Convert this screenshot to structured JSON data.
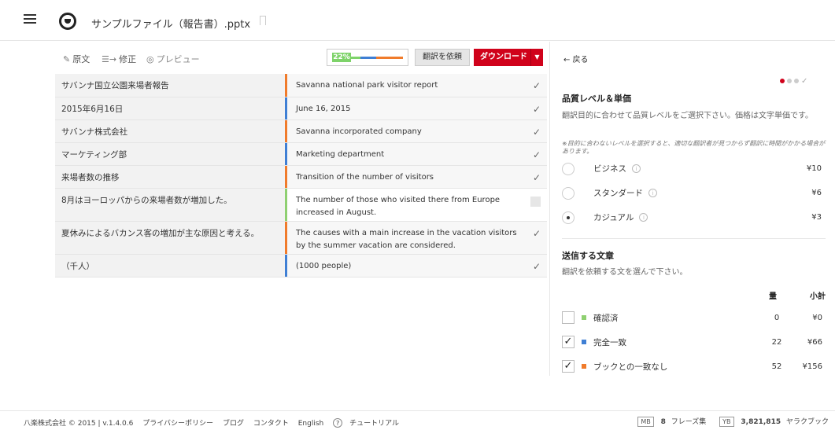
{
  "header": {
    "file_title": "サンプルファイル（報告書）.pptx"
  },
  "toolbar": {
    "modes": [
      "原文",
      "修正",
      "プレビュー"
    ],
    "progress_pct": "22%",
    "progress_fraction": 0.22,
    "request_label": "翻訳を依頼",
    "download_label": "ダウンロード",
    "colors": {
      "green": "#7ed36a",
      "orange": "#f07b2b",
      "blue": "#3f7fd4",
      "red": "#d0021b"
    }
  },
  "segments": [
    {
      "src": "サバンナ国立公園来場者報告",
      "tgt": "Savanna national park visitor report",
      "status": "orange",
      "checked": true
    },
    {
      "src": "2015年6月16日",
      "tgt": "June 16, 2015",
      "status": "blue",
      "checked": true
    },
    {
      "src": "サバンナ株式会社",
      "tgt": "Savanna incorporated company",
      "status": "orange",
      "checked": true
    },
    {
      "src": "マーケティング部",
      "tgt": "Marketing department",
      "status": "blue",
      "checked": true
    },
    {
      "src": "来場者数の推移",
      "tgt": "Transition of the number of visitors",
      "status": "orange",
      "checked": true
    },
    {
      "src": "8月はヨーロッパからの来場者数が増加した。",
      "tgt": "The number of those who visited there from Europe increased in August.",
      "status": "green",
      "checked": false
    },
    {
      "src": "夏休みによるバカンス客の増加が主な原因と考える。",
      "tgt": "The causes with a main increase in the vacation visitors by the summer vacation are considered.",
      "status": "orange",
      "checked": true
    },
    {
      "src": "（千人）",
      "tgt": "(1000 people)",
      "status": "blue",
      "checked": true
    }
  ],
  "panel": {
    "back_label": "← 戻る",
    "quality_title": "品質レベル＆単価",
    "quality_desc": "翻訳目的に合わせて品質レベルをご選択下さい。価格は文字単価です。",
    "quality_note": "※目的に合わないレベルを選択すると、適切な翻訳者が見つからず翻訳に時間がかかる場合があります。",
    "levels": [
      {
        "label": "ビジネス",
        "price": "¥10",
        "selected": false
      },
      {
        "label": "スタンダード",
        "price": "¥6",
        "selected": false
      },
      {
        "label": "カジュアル",
        "price": "¥3",
        "selected": true
      }
    ],
    "send_title": "送信する文章",
    "send_desc": "翻訳を依頼する文を選んで下さい。",
    "col_qty": "量",
    "col_subtotal": "小計",
    "send_rows": [
      {
        "label": "確認済",
        "qty": "0",
        "subtotal": "¥0",
        "checked": false,
        "color": "#8fd071"
      },
      {
        "label": "完全一致",
        "qty": "22",
        "subtotal": "¥66",
        "checked": true,
        "color": "#3f7fd4"
      },
      {
        "label": "ブックとの一致なし",
        "qty": "52",
        "subtotal": "¥156",
        "checked": true,
        "color": "#f07b2b"
      }
    ]
  },
  "footer": {
    "copyright": "八楽株式会社 © 2015 | v.1.4.0.6",
    "links": [
      "プライバシーポリシー",
      "ブログ",
      "コンタクト",
      "English"
    ],
    "tutorial": "チュートリアル",
    "mb_badge": "MB",
    "phrase_count": "8",
    "phrase_label": "フレーズ集",
    "yb_badge": "YB",
    "yb_count": "3,821,815",
    "yb_label": "ヤラクブック"
  }
}
